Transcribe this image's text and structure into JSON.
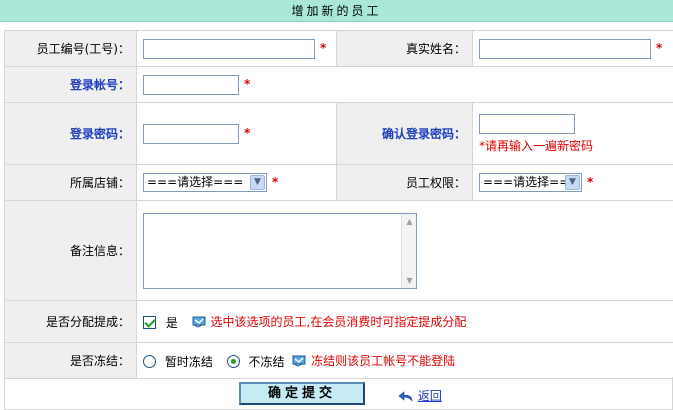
{
  "header": {
    "title": "增加新的员工"
  },
  "form": {
    "employee_no_label": "员工编号(工号)：",
    "real_name_label": "真实姓名：",
    "login_account_label": "登录帐号：",
    "login_password_label": "登录密码：",
    "confirm_password_label": "确认登录密码：",
    "confirm_password_hint": "*请再输入一遍新密码",
    "store_label": "所属店铺：",
    "store_select_value": "===请选择===",
    "permission_label": "员工权限：",
    "permission_select_value": "===请选择===",
    "remark_label": "备注信息：",
    "commission_label": "是否分配提成：",
    "commission_yes": "是",
    "commission_hint": "选中该选项的员工,在会员消费时可指定提成分配",
    "freeze_label": "是否冻结：",
    "freeze_option_temp": "暂时冻结",
    "freeze_option_no": "不冻结",
    "freeze_hint": "冻结则该员工帐号不能登陆",
    "required_mark": "*"
  },
  "footer": {
    "submit_label": "确定提交",
    "back_label": "返回"
  },
  "colors": {
    "header_bg": "#a9e8d9",
    "label_bg": "#efefef",
    "blue_label": "#1f3fbf",
    "required": "#e00000"
  }
}
